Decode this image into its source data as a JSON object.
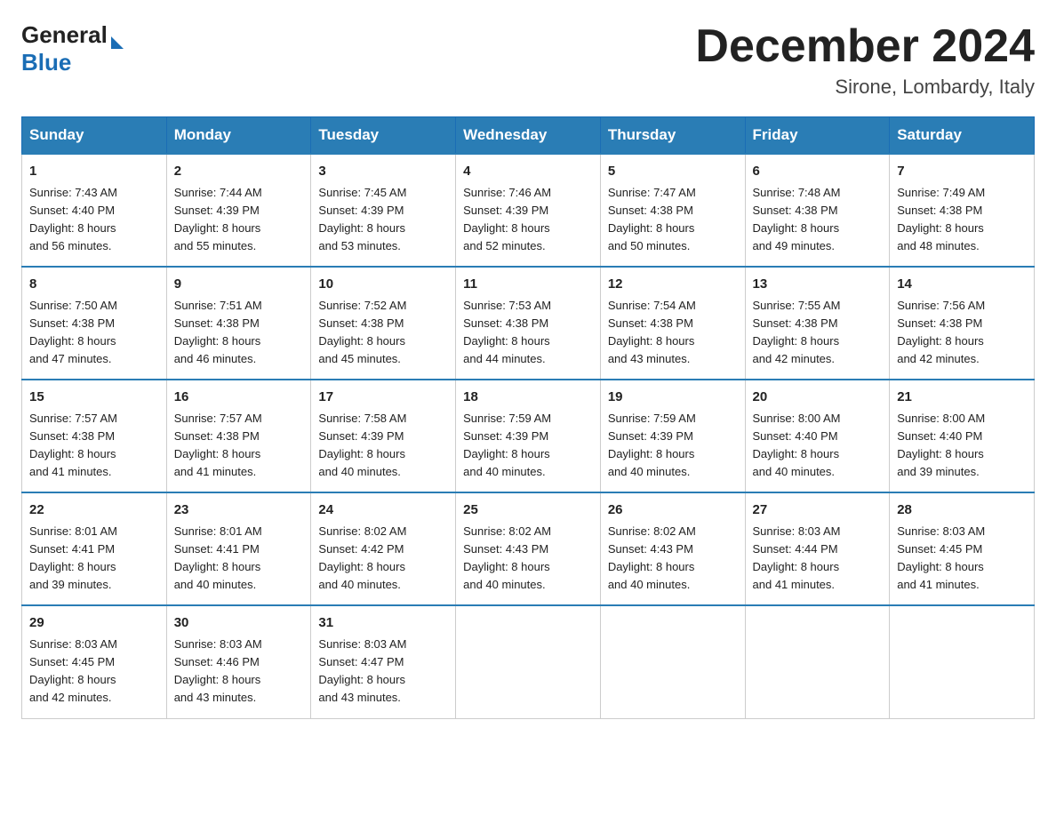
{
  "header": {
    "logo_general": "General",
    "logo_blue": "Blue",
    "month_title": "December 2024",
    "location": "Sirone, Lombardy, Italy"
  },
  "weekdays": [
    "Sunday",
    "Monday",
    "Tuesday",
    "Wednesday",
    "Thursday",
    "Friday",
    "Saturday"
  ],
  "weeks": [
    [
      {
        "day": "1",
        "sunrise": "7:43 AM",
        "sunset": "4:40 PM",
        "daylight": "8 hours and 56 minutes."
      },
      {
        "day": "2",
        "sunrise": "7:44 AM",
        "sunset": "4:39 PM",
        "daylight": "8 hours and 55 minutes."
      },
      {
        "day": "3",
        "sunrise": "7:45 AM",
        "sunset": "4:39 PM",
        "daylight": "8 hours and 53 minutes."
      },
      {
        "day": "4",
        "sunrise": "7:46 AM",
        "sunset": "4:39 PM",
        "daylight": "8 hours and 52 minutes."
      },
      {
        "day": "5",
        "sunrise": "7:47 AM",
        "sunset": "4:38 PM",
        "daylight": "8 hours and 50 minutes."
      },
      {
        "day": "6",
        "sunrise": "7:48 AM",
        "sunset": "4:38 PM",
        "daylight": "8 hours and 49 minutes."
      },
      {
        "day": "7",
        "sunrise": "7:49 AM",
        "sunset": "4:38 PM",
        "daylight": "8 hours and 48 minutes."
      }
    ],
    [
      {
        "day": "8",
        "sunrise": "7:50 AM",
        "sunset": "4:38 PM",
        "daylight": "8 hours and 47 minutes."
      },
      {
        "day": "9",
        "sunrise": "7:51 AM",
        "sunset": "4:38 PM",
        "daylight": "8 hours and 46 minutes."
      },
      {
        "day": "10",
        "sunrise": "7:52 AM",
        "sunset": "4:38 PM",
        "daylight": "8 hours and 45 minutes."
      },
      {
        "day": "11",
        "sunrise": "7:53 AM",
        "sunset": "4:38 PM",
        "daylight": "8 hours and 44 minutes."
      },
      {
        "day": "12",
        "sunrise": "7:54 AM",
        "sunset": "4:38 PM",
        "daylight": "8 hours and 43 minutes."
      },
      {
        "day": "13",
        "sunrise": "7:55 AM",
        "sunset": "4:38 PM",
        "daylight": "8 hours and 42 minutes."
      },
      {
        "day": "14",
        "sunrise": "7:56 AM",
        "sunset": "4:38 PM",
        "daylight": "8 hours and 42 minutes."
      }
    ],
    [
      {
        "day": "15",
        "sunrise": "7:57 AM",
        "sunset": "4:38 PM",
        "daylight": "8 hours and 41 minutes."
      },
      {
        "day": "16",
        "sunrise": "7:57 AM",
        "sunset": "4:38 PM",
        "daylight": "8 hours and 41 minutes."
      },
      {
        "day": "17",
        "sunrise": "7:58 AM",
        "sunset": "4:39 PM",
        "daylight": "8 hours and 40 minutes."
      },
      {
        "day": "18",
        "sunrise": "7:59 AM",
        "sunset": "4:39 PM",
        "daylight": "8 hours and 40 minutes."
      },
      {
        "day": "19",
        "sunrise": "7:59 AM",
        "sunset": "4:39 PM",
        "daylight": "8 hours and 40 minutes."
      },
      {
        "day": "20",
        "sunrise": "8:00 AM",
        "sunset": "4:40 PM",
        "daylight": "8 hours and 40 minutes."
      },
      {
        "day": "21",
        "sunrise": "8:00 AM",
        "sunset": "4:40 PM",
        "daylight": "8 hours and 39 minutes."
      }
    ],
    [
      {
        "day": "22",
        "sunrise": "8:01 AM",
        "sunset": "4:41 PM",
        "daylight": "8 hours and 39 minutes."
      },
      {
        "day": "23",
        "sunrise": "8:01 AM",
        "sunset": "4:41 PM",
        "daylight": "8 hours and 40 minutes."
      },
      {
        "day": "24",
        "sunrise": "8:02 AM",
        "sunset": "4:42 PM",
        "daylight": "8 hours and 40 minutes."
      },
      {
        "day": "25",
        "sunrise": "8:02 AM",
        "sunset": "4:43 PM",
        "daylight": "8 hours and 40 minutes."
      },
      {
        "day": "26",
        "sunrise": "8:02 AM",
        "sunset": "4:43 PM",
        "daylight": "8 hours and 40 minutes."
      },
      {
        "day": "27",
        "sunrise": "8:03 AM",
        "sunset": "4:44 PM",
        "daylight": "8 hours and 41 minutes."
      },
      {
        "day": "28",
        "sunrise": "8:03 AM",
        "sunset": "4:45 PM",
        "daylight": "8 hours and 41 minutes."
      }
    ],
    [
      {
        "day": "29",
        "sunrise": "8:03 AM",
        "sunset": "4:45 PM",
        "daylight": "8 hours and 42 minutes."
      },
      {
        "day": "30",
        "sunrise": "8:03 AM",
        "sunset": "4:46 PM",
        "daylight": "8 hours and 43 minutes."
      },
      {
        "day": "31",
        "sunrise": "8:03 AM",
        "sunset": "4:47 PM",
        "daylight": "8 hours and 43 minutes."
      },
      null,
      null,
      null,
      null
    ]
  ],
  "labels": {
    "sunrise": "Sunrise:",
    "sunset": "Sunset:",
    "daylight": "Daylight:"
  }
}
